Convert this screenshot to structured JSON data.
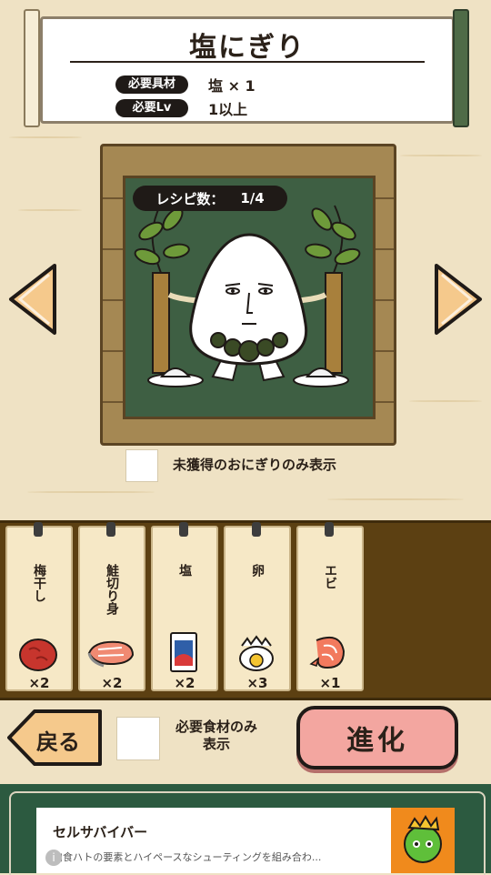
{
  "header": {
    "title": "塩にぎり",
    "requirements": [
      {
        "label": "必要具材",
        "value": "塩 × 1"
      },
      {
        "label": "必要Lv",
        "value": "1以上"
      }
    ]
  },
  "board": {
    "recipe_label": "レシピ数：",
    "recipe_count": "1/4"
  },
  "filters": {
    "unobtained_only": "未獲得のおにぎりのみ表示",
    "required_only": "必要食材のみ\n表示"
  },
  "ingredients": [
    {
      "name": "梅干し",
      "count": "×2",
      "icon": "umeboshi-icon"
    },
    {
      "name": "鮭切り身",
      "count": "×2",
      "icon": "salmon-icon"
    },
    {
      "name": "塩",
      "count": "×2",
      "icon": "salt-bag-icon"
    },
    {
      "name": "卵",
      "count": "×3",
      "icon": "egg-icon"
    },
    {
      "name": "エビ",
      "count": "×1",
      "icon": "shrimp-icon"
    }
  ],
  "buttons": {
    "back": "戻る",
    "evolve": "進化"
  },
  "ad": {
    "title": "セルサバイバー",
    "description": "肉食ハトの要素とハイペースなシューティングを組み合わ...",
    "info": "i"
  },
  "colors": {
    "background": "#efe2c4",
    "board": "#3e5f43",
    "tray": "#5c4012",
    "evolve": "#f3a6a0",
    "ad_frame": "#2c5a40"
  }
}
